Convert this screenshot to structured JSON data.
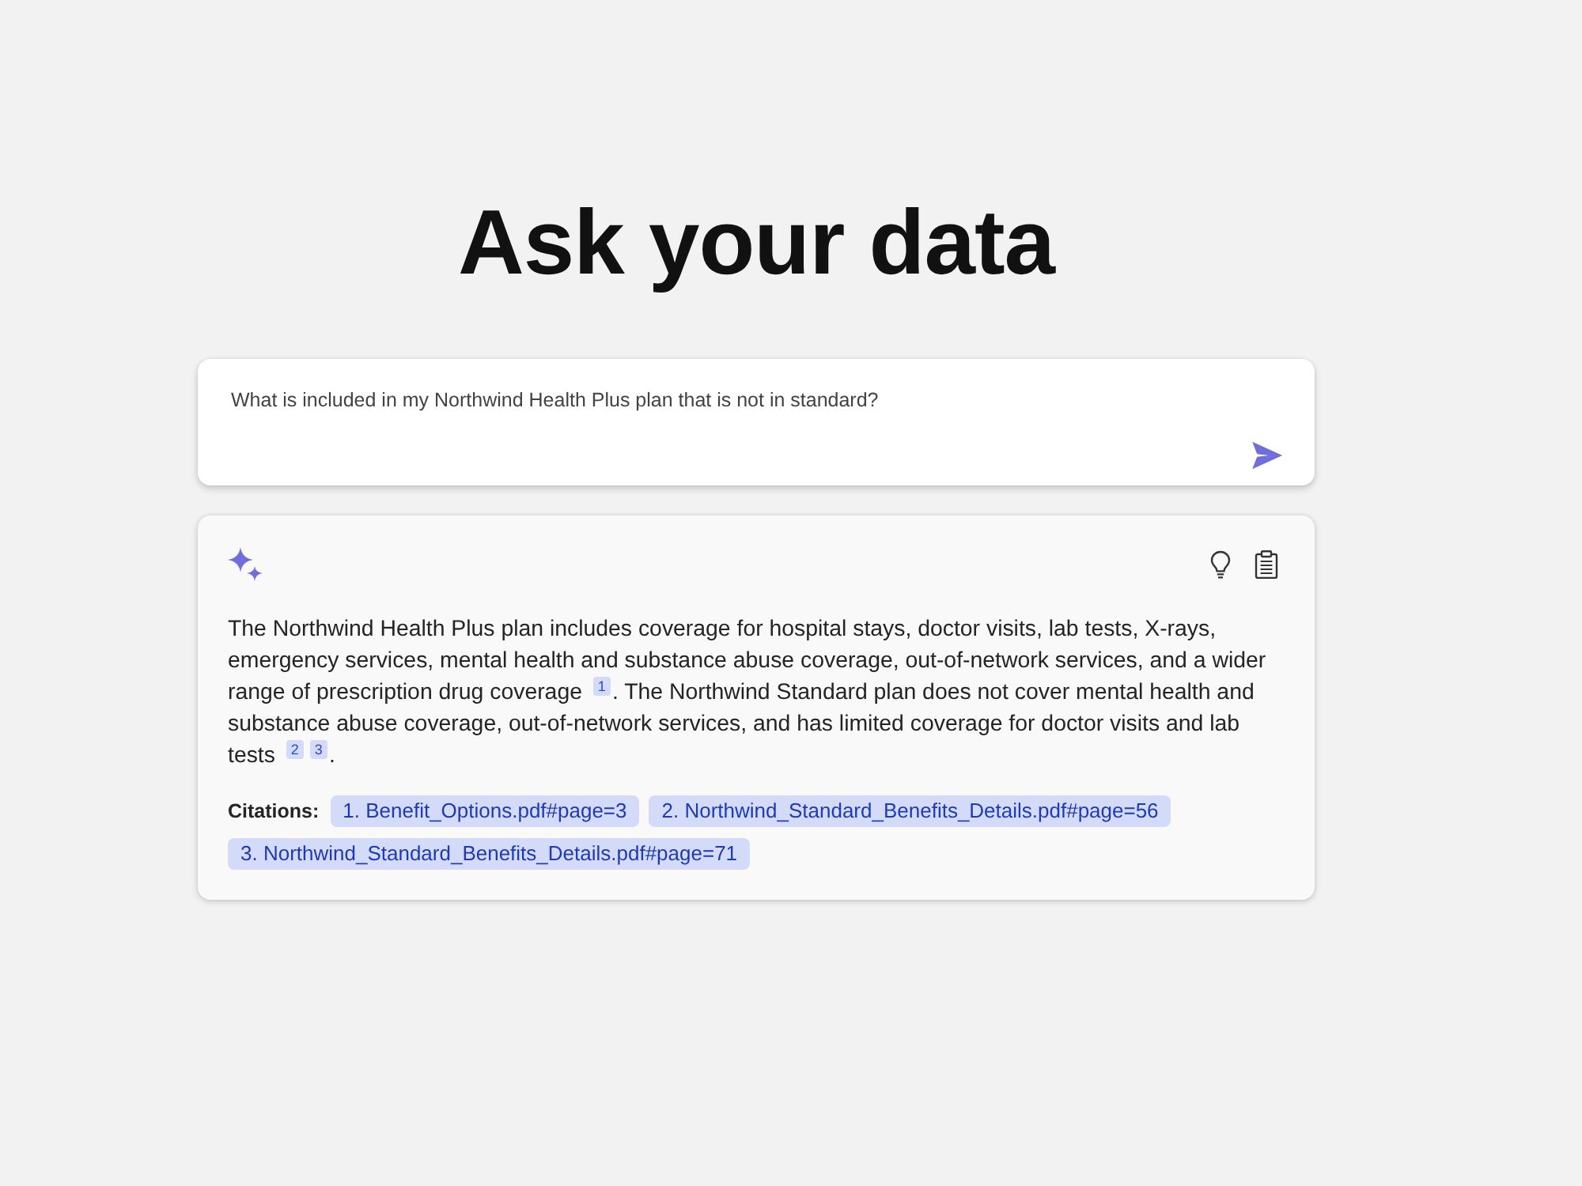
{
  "title": "Ask your data",
  "question": {
    "value": "What is included in my Northwind Health Plus plan that is not in standard?"
  },
  "answer": {
    "parts": [
      {
        "kind": "text",
        "text": "The Northwind Health Plus plan includes coverage for hospital stays, doctor visits, lab tests, X-rays, emergency services, mental health and substance abuse coverage, out-of-network services, and a wider range of prescription drug coverage "
      },
      {
        "kind": "citation",
        "text": "1"
      },
      {
        "kind": "text",
        "text": ". The Northwind Standard plan does not cover mental health and substance abuse coverage, out-of-network services, and has limited coverage for doctor visits and lab tests "
      },
      {
        "kind": "citation",
        "text": "2"
      },
      {
        "kind": "citation",
        "text": "3"
      },
      {
        "kind": "text",
        "text": "."
      }
    ],
    "citations_label": "Citations:",
    "citations": [
      "1. Benefit_Options.pdf#page=3",
      "2. Northwind_Standard_Benefits_Details.pdf#page=56",
      "3. Northwind_Standard_Benefits_Details.pdf#page=71"
    ]
  }
}
